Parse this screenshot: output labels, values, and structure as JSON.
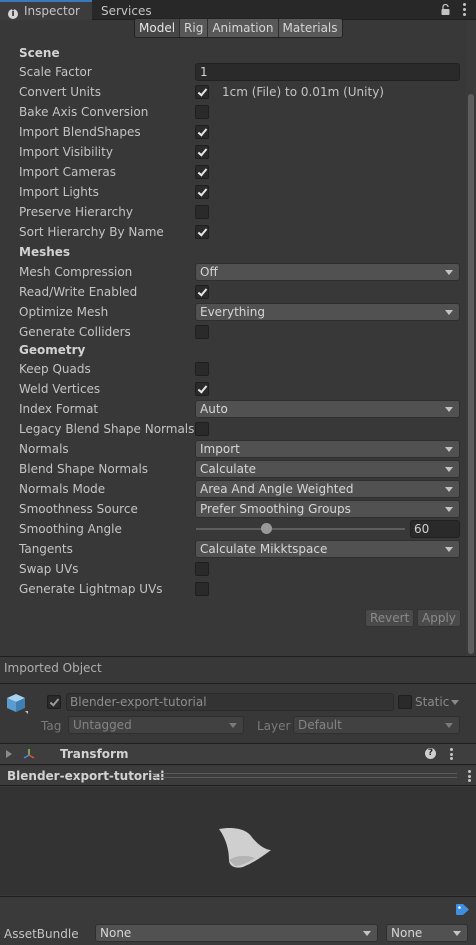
{
  "tabs": {
    "inspector": "Inspector",
    "services": "Services"
  },
  "subtabs": [
    "Model",
    "Rig",
    "Animation",
    "Materials"
  ],
  "scene": {
    "header": "Scene",
    "scale_factor_label": "Scale Factor",
    "scale_factor_value": "1",
    "convert_units_label": "Convert Units",
    "convert_units_note": "1cm (File) to 0.01m (Unity)",
    "bake_axis_label": "Bake Axis Conversion",
    "import_blendshapes_label": "Import BlendShapes",
    "import_visibility_label": "Import Visibility",
    "import_cameras_label": "Import Cameras",
    "import_lights_label": "Import Lights",
    "preserve_hierarchy_label": "Preserve Hierarchy",
    "sort_hierarchy_label": "Sort Hierarchy By Name"
  },
  "meshes": {
    "header": "Meshes",
    "mesh_compression_label": "Mesh Compression",
    "mesh_compression_value": "Off",
    "read_write_label": "Read/Write Enabled",
    "optimize_mesh_label": "Optimize Mesh",
    "optimize_mesh_value": "Everything",
    "generate_colliders_label": "Generate Colliders"
  },
  "geometry": {
    "header": "Geometry",
    "keep_quads_label": "Keep Quads",
    "weld_vertices_label": "Weld Vertices",
    "index_format_label": "Index Format",
    "index_format_value": "Auto",
    "legacy_blend_label": "Legacy Blend Shape Normals",
    "normals_label": "Normals",
    "normals_value": "Import",
    "blend_shape_normals_label": "Blend Shape Normals",
    "blend_shape_normals_value": "Calculate",
    "normals_mode_label": "Normals Mode",
    "normals_mode_value": "Area And Angle Weighted",
    "smoothness_source_label": "Smoothness Source",
    "smoothness_source_value": "Prefer Smoothing Groups",
    "smoothing_angle_label": "Smoothing Angle",
    "smoothing_angle_value": "60",
    "tangents_label": "Tangents",
    "tangents_value": "Calculate Mikktspace",
    "swap_uvs_label": "Swap UVs",
    "generate_lightmap_label": "Generate Lightmap UVs"
  },
  "buttons": {
    "revert": "Revert",
    "apply": "Apply"
  },
  "imported_object": {
    "title": "Imported Object",
    "name": "Blender-export-tutorial",
    "static_label": "Static",
    "tag_label": "Tag",
    "tag_value": "Untagged",
    "layer_label": "Layer",
    "layer_value": "Default"
  },
  "transform": {
    "title": "Transform"
  },
  "preview": {
    "title": "Blender-export-tutorial"
  },
  "asset_bundle": {
    "label": "AssetBundle",
    "name_value": "None",
    "variant_value": "None"
  }
}
